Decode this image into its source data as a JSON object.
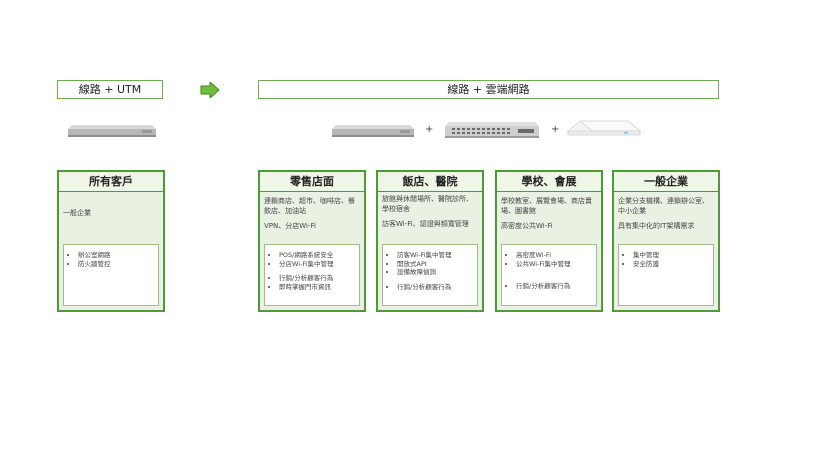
{
  "left_header": "線路 + UTM",
  "right_header": "線路 + 雲端網路",
  "plus_sign": "+",
  "colors": {
    "accent_green": "#4e9a34",
    "card_bg": "#e9f1e3",
    "arrow_green": "#6fbe3c"
  },
  "cards": [
    {
      "title": "所有客戶",
      "desc": [
        "一般企業"
      ],
      "items": [
        "辦公室網路",
        "防火牆管控"
      ]
    },
    {
      "title": "零售店面",
      "desc": [
        "連鎖商店、超市、咖啡店、餐飲店、加油站",
        "VPN、分店Wi-Fi"
      ],
      "items": [
        "POS/網路系統安全",
        "分店Wi-Fi集中管理",
        "行銷/分析顧客行為",
        "即時掌握門市資訊"
      ]
    },
    {
      "title": "飯店、醫院",
      "desc": [
        "旅館與休閒場所、醫院診所、學校宿舍",
        "訪客Wi-Fi、認證與頻寬管理"
      ],
      "items": [
        "訪客Wi-Fi集中管理",
        "開放式API",
        "設備故障偵測",
        "行銷/分析顧客行為"
      ]
    },
    {
      "title": "學校、會展",
      "desc": [
        "學校教室、展覽會場、商店賣場、圖書館",
        "高密度公共Wi-Fi"
      ],
      "items": [
        "高密度Wi-Fi",
        "公共Wi-Fi集中管理",
        "行銷/分析顧客行為"
      ]
    },
    {
      "title": "一般企業",
      "desc": [
        "企業分支機構、連鎖辦公室、中小企業",
        "具有集中化的IT架構需求"
      ],
      "items": [
        "集中管理",
        "安全防護"
      ]
    }
  ]
}
